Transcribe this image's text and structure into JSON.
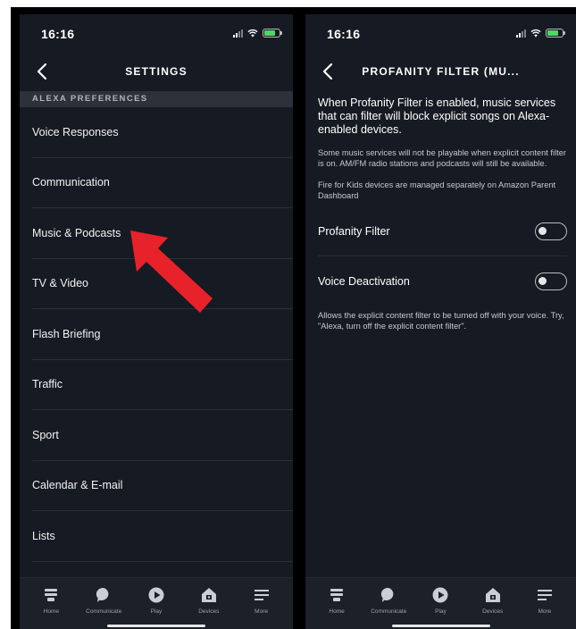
{
  "left": {
    "status": {
      "time": "16:16"
    },
    "title": "SETTINGS",
    "section_header": "ALEXA PREFERENCES",
    "items": [
      {
        "label": "Voice Responses"
      },
      {
        "label": "Communication"
      },
      {
        "label": "Music & Podcasts"
      },
      {
        "label": "TV & Video"
      },
      {
        "label": "Flash Briefing"
      },
      {
        "label": "Traffic"
      },
      {
        "label": "Sport"
      },
      {
        "label": "Calendar & E-mail"
      },
      {
        "label": "Lists"
      }
    ]
  },
  "right": {
    "status": {
      "time": "16:16"
    },
    "title": "PROFANITY FILTER (MU...",
    "lead": "When Profanity Filter is enabled, music services that can filter will block explicit songs on Alexa-enabled devices.",
    "note1": "Some music services will not be playable when explicit content filter is on. AM/FM radio stations and podcasts will still be available.",
    "note2": "Fire for Kids devices are managed separately on Amazon Parent Dashboard",
    "toggles": [
      {
        "label": "Profanity Filter",
        "on": false
      },
      {
        "label": "Voice Deactivation",
        "on": false
      }
    ],
    "footer_note": "Allows the explicit content filter to be turned off with your voice. Try, \"Alexa, turn off the explicit content filter\"."
  },
  "tabs": [
    {
      "label": "Home",
      "icon": "home-icon"
    },
    {
      "label": "Communicate",
      "icon": "communicate-icon"
    },
    {
      "label": "Play",
      "icon": "play-icon"
    },
    {
      "label": "Devices",
      "icon": "devices-icon"
    },
    {
      "label": "More",
      "icon": "more-icon"
    }
  ],
  "colors": {
    "background": "#161a22",
    "section_header": "#2c313b",
    "tabbar": "#1c2029",
    "arrow": "#e8222a"
  }
}
